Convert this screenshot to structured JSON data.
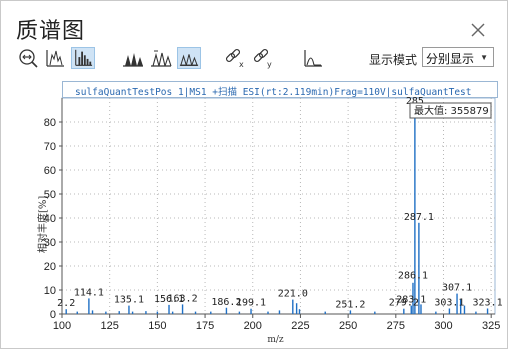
{
  "window": {
    "title": "质谱图",
    "close_icon": "close-icon"
  },
  "toolbar": {
    "mode_label": "显示模式",
    "mode_value": "分别显示",
    "icons": [
      "zoom-fit-icon",
      "centroid-icon",
      "profile-bar-icon",
      "peak-label-icon",
      "peak-label-mass-icon",
      "peak-label-area-icon",
      "link-x-icon",
      "link-y-icon",
      "integrate-icon"
    ]
  },
  "header": {
    "text": "sulfaQuantTestPos_1|MS1 +扫描 ESI(rt:2.119min)Frag=110V|sulfaQuantTest"
  },
  "tooltip": {
    "text": "最大值: 355879"
  },
  "chart_data": {
    "type": "bar",
    "xlabel": "m/z",
    "ylabel": "相对丰度[%]",
    "xlim": [
      100,
      327
    ],
    "ylim": [
      0,
      90
    ],
    "xticks": [
      100,
      125,
      150,
      175,
      200,
      225,
      250,
      275,
      300,
      325
    ],
    "yticks": [
      0,
      10,
      20,
      30,
      40,
      50,
      60,
      70,
      80
    ],
    "peaks": [
      {
        "x": 102.2,
        "y": 2.0,
        "label": "2.2"
      },
      {
        "x": 108.0,
        "y": 1.0
      },
      {
        "x": 114.1,
        "y": 6.5,
        "label": "114.1"
      },
      {
        "x": 116.0,
        "y": 1.5
      },
      {
        "x": 123.0,
        "y": 1.0
      },
      {
        "x": 130.0,
        "y": 1.2
      },
      {
        "x": 135.1,
        "y": 3.5,
        "label": "135.1"
      },
      {
        "x": 137.0,
        "y": 1.0
      },
      {
        "x": 144.0,
        "y": 1.2
      },
      {
        "x": 150.0,
        "y": 1.0
      },
      {
        "x": 156.1,
        "y": 3.8,
        "label": "156.1"
      },
      {
        "x": 158.0,
        "y": 1.0
      },
      {
        "x": 163.2,
        "y": 4.0,
        "label": "163.2"
      },
      {
        "x": 170.0,
        "y": 1.0
      },
      {
        "x": 178.0,
        "y": 1.0
      },
      {
        "x": 186.2,
        "y": 2.6,
        "label": "186.2"
      },
      {
        "x": 193.0,
        "y": 1.0
      },
      {
        "x": 199.1,
        "y": 2.2,
        "label": "199.1"
      },
      {
        "x": 208.0,
        "y": 1.0
      },
      {
        "x": 214.0,
        "y": 1.5
      },
      {
        "x": 221.0,
        "y": 6.0,
        "label": "221.0"
      },
      {
        "x": 223.0,
        "y": 4.5
      },
      {
        "x": 224.5,
        "y": 2.0
      },
      {
        "x": 238.0,
        "y": 1.0
      },
      {
        "x": 251.2,
        "y": 1.5,
        "label": "251.2"
      },
      {
        "x": 264.0,
        "y": 1.0
      },
      {
        "x": 279.2,
        "y": 2.2,
        "label": "279.2"
      },
      {
        "x": 283.1,
        "y": 3.5,
        "label": "283.1"
      },
      {
        "x": 284.0,
        "y": 13.0,
        "label": "286.1"
      },
      {
        "x": 285.0,
        "y": 87.0,
        "label": "285"
      },
      {
        "x": 287.1,
        "y": 38.0,
        "label": "287.1"
      },
      {
        "x": 288.2,
        "y": 4.0
      },
      {
        "x": 296.0,
        "y": 1.0
      },
      {
        "x": 303.1,
        "y": 2.3,
        "label": "303.1"
      },
      {
        "x": 307.1,
        "y": 8.5,
        "label": "307.1"
      },
      {
        "x": 309.0,
        "y": 6.0
      },
      {
        "x": 311.0,
        "y": 3.5
      },
      {
        "x": 317.0,
        "y": 1.0
      },
      {
        "x": 323.1,
        "y": 2.3,
        "label": "323.1"
      }
    ]
  }
}
